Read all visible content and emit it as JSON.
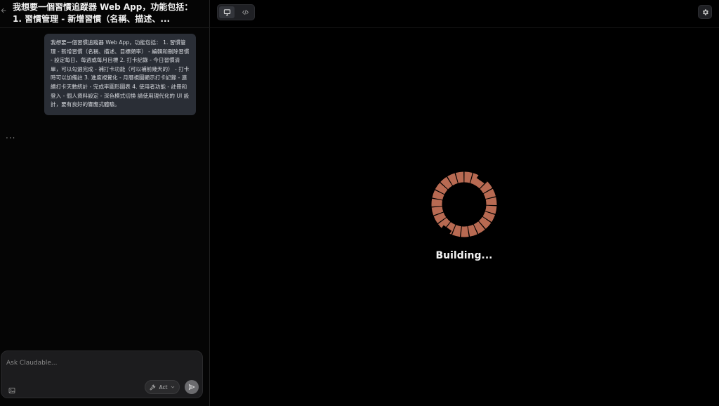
{
  "chat": {
    "title": "我想要一個習慣追蹤器 Web App，功能包括： 1. 習慣管理 - 新增習慣（名稱、描述、...",
    "user_message": "我想要一個習慣追蹤器 Web App，功能包括： 1. 習慣管理 - 新增習慣（名稱、描述、目標頻率） - 編輯和刪除習慣 - 設定每日、每週或每月目標 2. 打卡記錄 - 今日習慣清單，可以勾選完成 - 補打卡功能（可以補前幾天的） - 打卡時可以加備註 3. 進度視覺化 - 月曆視圖顯示打卡記錄 - 連續打卡天數統計 - 完成率圖形圖表 4. 使用者功能 - 註冊和登入 - 個人資料設定 - 深色模式切換 請使用現代化的 UI 設計，要有良好的響應式體驗。",
    "typing_indicator": "...",
    "back_icon": "arrow-left-icon"
  },
  "composer": {
    "placeholder": "Ask Claudable...",
    "value": "",
    "mode_label": "Act",
    "attach_icon": "image-icon",
    "mode_icon": "wrench-icon",
    "send_icon": "send-icon"
  },
  "preview": {
    "status_text": "Building...",
    "toggle_icons": [
      "monitor-icon",
      "code-icon"
    ],
    "active_view": "monitor-icon",
    "settings_icon": "gear-icon",
    "spinner_color": "#b86a52"
  }
}
